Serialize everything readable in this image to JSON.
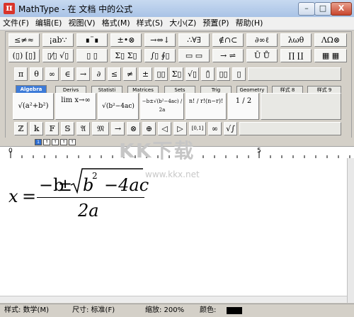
{
  "window": {
    "title": "MathType - 在 文档 中的公式",
    "icon_letter": "π"
  },
  "window_buttons": {
    "minimize": "–",
    "maximize": "□",
    "close": "X"
  },
  "menu": [
    "文件(F)",
    "编辑(E)",
    "视图(V)",
    "格式(M)",
    "样式(S)",
    "大小(Z)",
    "预置(P)",
    "帮助(H)"
  ],
  "palette": {
    "row1": [
      "≤≠≈",
      "¡ab∵",
      "∎¨∎",
      "±•⊗",
      "→⇔↓",
      "∴∀∃",
      "∉∩⊂",
      "∂∞ℓ",
      "λωθ",
      "ΛΩ⊗"
    ],
    "row2": [
      "(▯) [▯]",
      "▯⁄▯ √▯",
      "▯ ▯",
      "Σ▯ Σ▯",
      "∫▯ ∮▯",
      "▭ ▭",
      "→ ⇌",
      "Ū Ů",
      "∏ ∐",
      "▦ ▦"
    ],
    "row3": [
      "π",
      "θ",
      "∞",
      "∈",
      "→",
      "∂",
      "≤",
      "≠",
      "±",
      "▯▯",
      "Σ▯",
      "√▯",
      "▯̄",
      "▯▯",
      "▯"
    ],
    "tabs": [
      "Algebra",
      "Derivs",
      "Statisti",
      "Matrices",
      "Sets",
      "Trig",
      "Geometry",
      "样式 8",
      "样式 9"
    ],
    "templates": [
      "√(a²+b²)",
      "lim x→∞",
      "√(b²−4ac)",
      "−b±√(b²−4ac) / 2a",
      "n! / r!(n−r)!",
      "1 / 2"
    ],
    "row5": [
      "ℤ",
      "𝕜",
      "𝔽",
      "𝕊",
      "𝔄",
      "𝔐",
      "→",
      "⊗",
      "⊕",
      "◁",
      "▷",
      "[0,1]",
      "∞",
      "√∫"
    ]
  },
  "strip_buttons": [
    "1",
    "↑",
    "↑",
    "↑",
    "↑"
  ],
  "ruler": {
    "zero": "0",
    "five": "5"
  },
  "equation": {
    "lhs": "x",
    "eq": "=",
    "minus_b": "−b",
    "pm": "±",
    "b": "b",
    "exp": "2",
    "rest": "−4ac",
    "denominator": "2a"
  },
  "watermark": {
    "logo": "KK下载",
    "url": "www.kkx.net"
  },
  "status": {
    "style": "样式: 数学(M)",
    "size": "尺寸: 标准(F)",
    "zoom": "缩放: 200%",
    "color_label": "颜色:",
    "color": "#000000"
  }
}
